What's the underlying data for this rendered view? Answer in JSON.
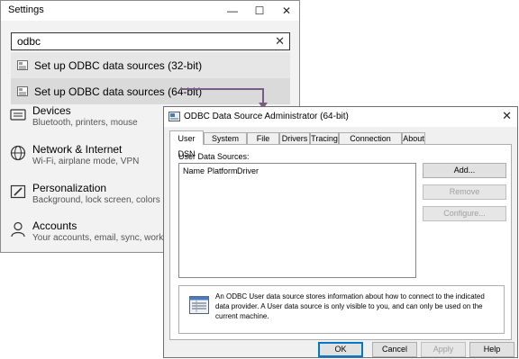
{
  "settings": {
    "title": "Settings",
    "window_controls": {
      "minimize": "—",
      "maximize": "☐",
      "close": "✕"
    },
    "search": {
      "value": "odbc",
      "clear": "✕"
    },
    "results": [
      {
        "label": "Set up ODBC data sources (32-bit)",
        "icon": "odbc-setup-icon",
        "selected": false
      },
      {
        "label": "Set up ODBC data sources (64-bit)",
        "icon": "odbc-setup-icon",
        "selected": true
      }
    ],
    "categories": [
      {
        "title": "Devices",
        "subtitle": "Bluetooth, printers, mouse",
        "icon": "keyboard-icon"
      },
      {
        "title": "Network & Internet",
        "subtitle": "Wi-Fi, airplane mode, VPN",
        "icon": "globe-icon"
      },
      {
        "title": "Personalization",
        "subtitle": "Background, lock screen, colors",
        "icon": "paint-icon"
      },
      {
        "title": "Accounts",
        "subtitle": "Your accounts, email, sync, work, family",
        "icon": "person-icon"
      }
    ]
  },
  "odbc": {
    "title": "ODBC Data Source Administrator (64-bit)",
    "close": "✕",
    "tabs": [
      "User DSN",
      "System DSN",
      "File DSN",
      "Drivers",
      "Tracing",
      "Connection Pooling",
      "About"
    ],
    "active_tab": "User DSN",
    "list_label": "User Data Sources:",
    "columns": [
      "Name",
      "Platform",
      "Driver"
    ],
    "buttons": {
      "add": "Add...",
      "remove": "Remove",
      "configure": "Configure..."
    },
    "info_text": "An ODBC User data source stores information about how to connect to the indicated data provider.  A User data source is only visible to you, and can only be used on the current machine.",
    "footer": {
      "ok": "OK",
      "cancel": "Cancel",
      "apply": "Apply",
      "help": "Help"
    }
  },
  "colors": {
    "connector": "#7b5a86",
    "primary_border": "#0078d7"
  }
}
